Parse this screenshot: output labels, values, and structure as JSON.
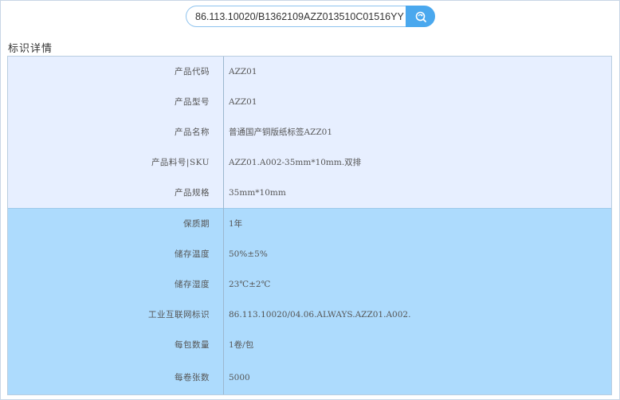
{
  "search": {
    "value": "86.113.10020/B1362109AZZ013510C01516YY",
    "button_icon": "search-refresh-icon"
  },
  "section": {
    "title": "标识详情"
  },
  "colors": {
    "light_row": "#e7efff",
    "dark_row": "#addbfd",
    "accent": "#4aa8ee"
  },
  "details": {
    "rows": [
      {
        "label": "产品代码",
        "value": "AZZ01"
      },
      {
        "label": "产品型号",
        "value": "AZZ01"
      },
      {
        "label": "产品名称",
        "value": "普通国产铜版纸标签AZZ01"
      },
      {
        "label": "产品料号|SKU",
        "value": "AZZ01.A002-35mm*10mm.双排"
      },
      {
        "label": "产品规格",
        "value": "35mm*10mm"
      },
      {
        "label": "保质期",
        "value": "1年"
      },
      {
        "label": "储存温度",
        "value": "50%±5%"
      },
      {
        "label": "储存湿度",
        "value": "23℃±2℃"
      },
      {
        "label": "工业互联网标识",
        "value": "86.113.10020/04.06.ALWAYS.AZZ01.A002."
      },
      {
        "label": "每包数量",
        "value": "1卷/包"
      },
      {
        "label": "每卷张数",
        "value": "5000"
      }
    ]
  }
}
